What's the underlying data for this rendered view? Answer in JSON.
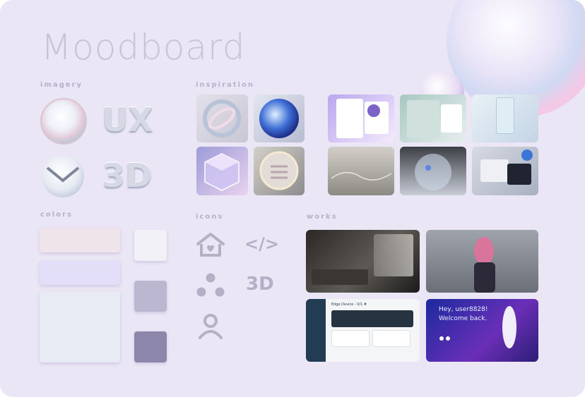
{
  "title": "Moodboard",
  "sections": {
    "imagery": "imagery",
    "inspiration": "inspiration",
    "colors": "colors",
    "icons": "icons",
    "works": "works"
  },
  "imagery": {
    "ux_text": "UX",
    "three_d_text": "3D"
  },
  "colors": [
    "#efe4e9",
    "#e4dff8",
    "#e9ebf4",
    "#f3f1f8",
    "#bcb7d1",
    "#8c86ab"
  ],
  "icons": {
    "names": [
      "heart-house-icon",
      "code-icon",
      "three-dots-icon",
      "3d-icon",
      "user-icon"
    ],
    "code_text": "</>",
    "three_d_text": "3D"
  },
  "works": {
    "greeting": "Hey, user8828!",
    "welcome": "Welcome back.",
    "dashboard_title": "Edge Device - 0/1 #"
  }
}
